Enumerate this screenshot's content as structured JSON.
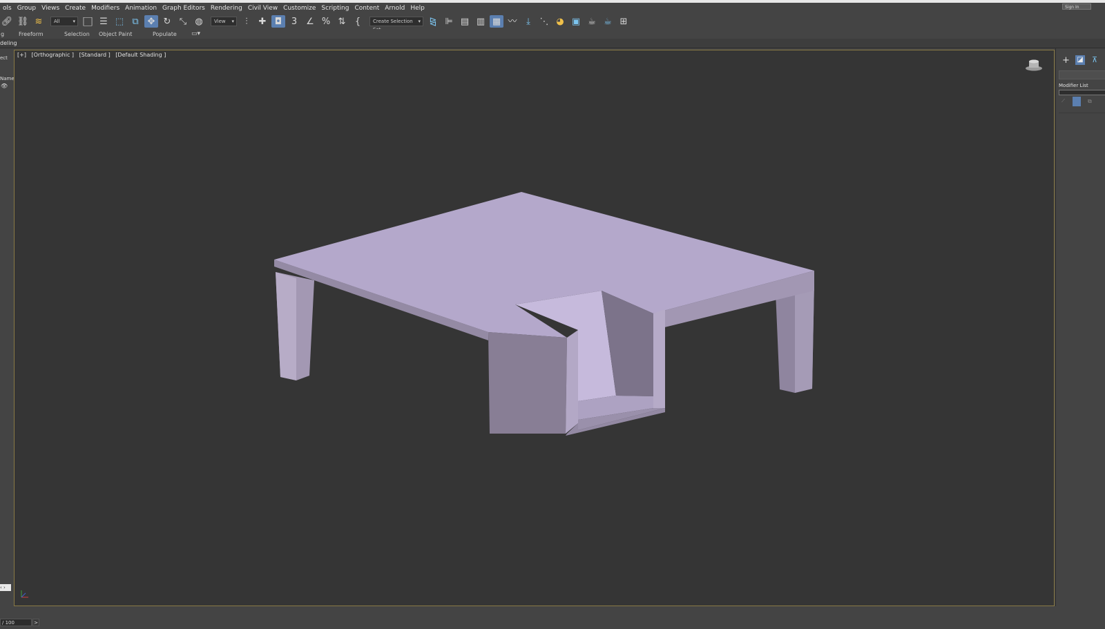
{
  "menu": [
    "ols",
    "Group",
    "Views",
    "Create",
    "Modifiers",
    "Animation",
    "Graph Editors",
    "Rendering",
    "Civil View",
    "Customize",
    "Scripting",
    "Content",
    "Arnold",
    "Help"
  ],
  "signin_label": "Sign In",
  "toolbar": {
    "filter_value": "All",
    "ref_coord_value": "View",
    "selection_set_placeholder": "Create Selection Set"
  },
  "ribbon_tabs": [
    "g",
    "Freeform",
    "Selection",
    "Object Paint",
    "Populate"
  ],
  "subrow_label": "deling",
  "left_panel": {
    "text1": "ect",
    "text2": "Name"
  },
  "viewport": {
    "label_parts": [
      "[+]",
      "[Orthographic ]",
      "[Standard ]",
      "[Default Shading ]"
    ]
  },
  "right_panel": {
    "modifier_list_label": "Modifier List"
  },
  "status": {
    "frame_value": "/ 100",
    "next_label": ">"
  },
  "colors": {
    "background": "#444444",
    "viewport": "#353535",
    "active_button": "#5b7fb0",
    "model_top": "#b5a8cc",
    "model_side": "#8d8399"
  }
}
